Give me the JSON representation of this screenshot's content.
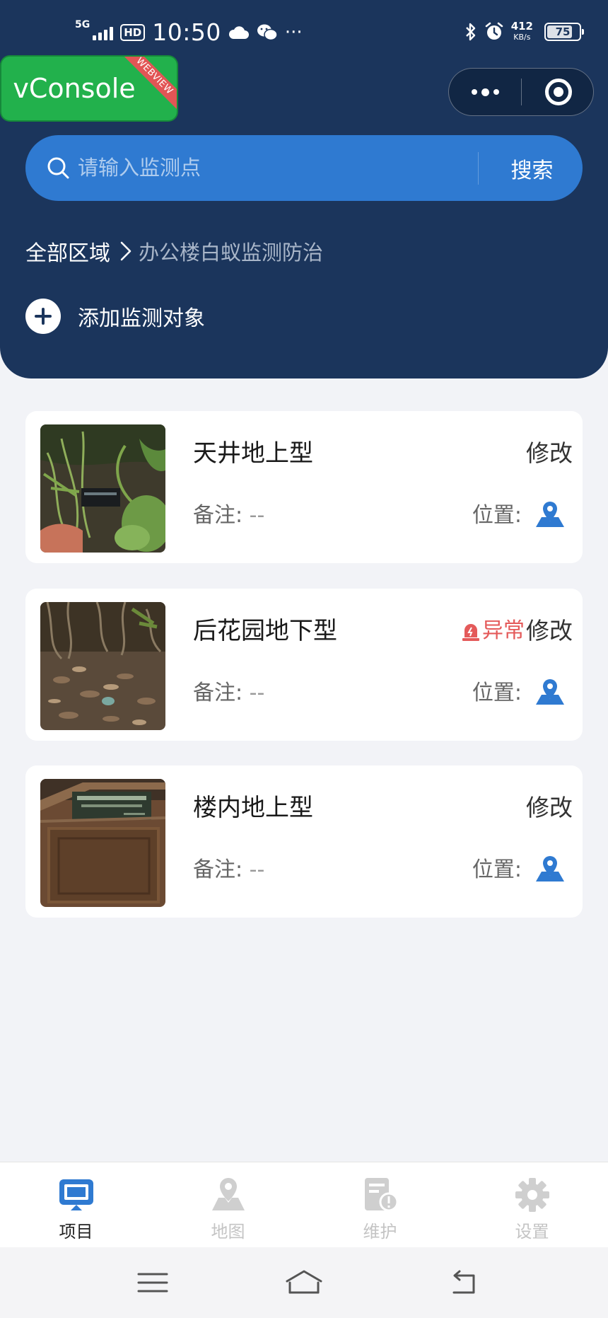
{
  "status_bar": {
    "network": "5G",
    "hd_badge": "HD",
    "time": "10:50",
    "more": "···",
    "net_speed_value": "412",
    "net_speed_unit": "KB/s",
    "battery": "75"
  },
  "vconsole": {
    "label": "vConsole",
    "ribbon": "WEBVIEW"
  },
  "search": {
    "placeholder": "请输入监测点",
    "button_label": "搜索"
  },
  "breadcrumb": {
    "root": "全部区域",
    "current": "办公楼白蚁监测防治"
  },
  "add_object": {
    "label": "添加监测对象"
  },
  "items": [
    {
      "title": "天井地上型",
      "edit_label": "修改",
      "remark_label": "备注:",
      "remark_value": "--",
      "location_label": "位置:",
      "alert": ""
    },
    {
      "title": "后花园地下型",
      "edit_label": "修改",
      "remark_label": "备注:",
      "remark_value": "--",
      "location_label": "位置:",
      "alert": "异常"
    },
    {
      "title": "楼内地上型",
      "edit_label": "修改",
      "remark_label": "备注:",
      "remark_value": "--",
      "location_label": "位置:",
      "alert": ""
    }
  ],
  "tabbar": {
    "tabs": [
      {
        "label": "项目",
        "icon": "monitor-icon",
        "active": true
      },
      {
        "label": "地图",
        "icon": "map-icon",
        "active": false
      },
      {
        "label": "维护",
        "icon": "maintenance-icon",
        "active": false
      },
      {
        "label": "设置",
        "icon": "gear-icon",
        "active": false
      }
    ]
  },
  "colors": {
    "header_bg": "#1b355c",
    "search_bg": "#2f7ad1",
    "accent_blue": "#2f7ad1",
    "alert_red": "#e45a5a",
    "vconsole_green": "#22b14c"
  }
}
